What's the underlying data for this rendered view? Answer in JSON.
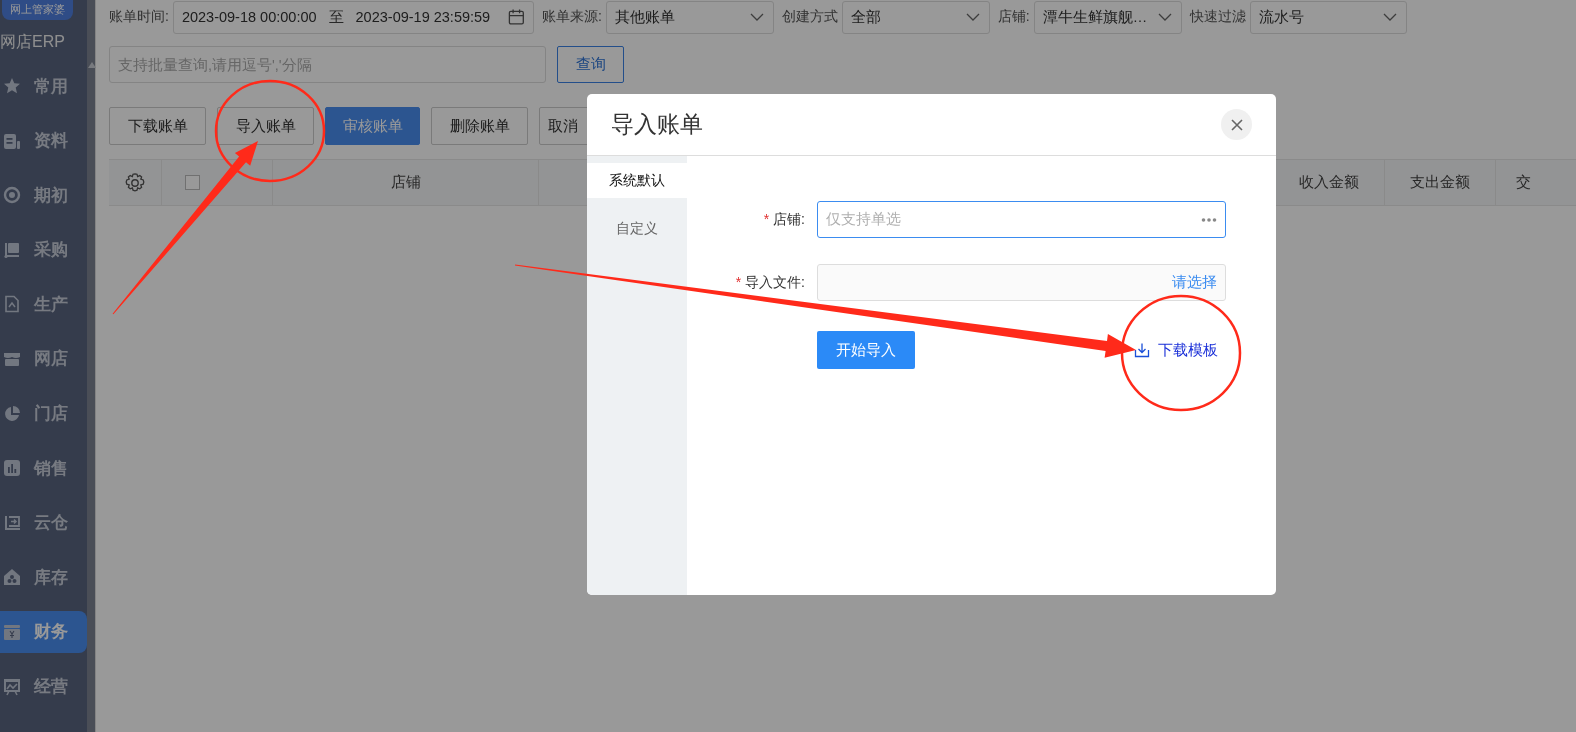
{
  "sidebar": {
    "logo": "网上管家婆",
    "brand": "网店ERP",
    "items": [
      {
        "label": "常用",
        "selected": false
      },
      {
        "label": "资料",
        "selected": false
      },
      {
        "label": "期初",
        "selected": false
      },
      {
        "label": "采购",
        "selected": false
      },
      {
        "label": "生产",
        "selected": false
      },
      {
        "label": "网店",
        "selected": false
      },
      {
        "label": "门店",
        "selected": false
      },
      {
        "label": "销售",
        "selected": false
      },
      {
        "label": "云仓",
        "selected": false
      },
      {
        "label": "库存",
        "selected": false
      },
      {
        "label": "财务",
        "selected": true
      },
      {
        "label": "经营",
        "selected": false
      }
    ]
  },
  "filters": [
    {
      "kind": "daterange",
      "label": "账单时间:",
      "start": "2023-09-18 00:00:00",
      "separator": "至",
      "end": "2023-09-19 23:59:59"
    },
    {
      "kind": "select",
      "label": "账单来源:",
      "value": "其他账单"
    },
    {
      "kind": "select",
      "label": "创建方式",
      "value": "全部"
    },
    {
      "kind": "select",
      "label": "店铺:",
      "value": "潭牛生鲜旗舰…"
    },
    {
      "kind": "select",
      "label": "快速过滤",
      "value": "流水号"
    }
  ],
  "search": {
    "placeholder": "支持批量查询,请用逗号','分隔",
    "button": "查询"
  },
  "actions": [
    {
      "label": "下载账单",
      "kind": "default"
    },
    {
      "label": "导入账单",
      "kind": "default"
    },
    {
      "label": "审核账单",
      "kind": "primary"
    },
    {
      "label": "删除账单",
      "kind": "default"
    },
    {
      "label": "取消",
      "kind": "default"
    }
  ],
  "table": {
    "columns": [
      {
        "kind": "settings"
      },
      {
        "kind": "checkbox",
        "checked": false
      },
      {
        "kind": "text",
        "label": "店铺"
      },
      {
        "kind": "gap"
      },
      {
        "kind": "text",
        "label": "收入金额"
      },
      {
        "kind": "text",
        "label": "支出金额"
      },
      {
        "kind": "text",
        "label": "交"
      }
    ]
  },
  "dialog": {
    "title": "导入账单",
    "tabs": [
      {
        "label": "系统默认",
        "selected": true
      },
      {
        "label": "自定义",
        "selected": false
      }
    ],
    "fields": [
      {
        "kind": "picker",
        "required_mark": "*",
        "label": "店铺:",
        "placeholder": "仅支持单选",
        "focused": true
      },
      {
        "kind": "file",
        "required_mark": "*",
        "label": "导入文件:",
        "action": "请选择",
        "focused": false
      }
    ],
    "submit": "开始导入",
    "template_link": "下载模板"
  }
}
